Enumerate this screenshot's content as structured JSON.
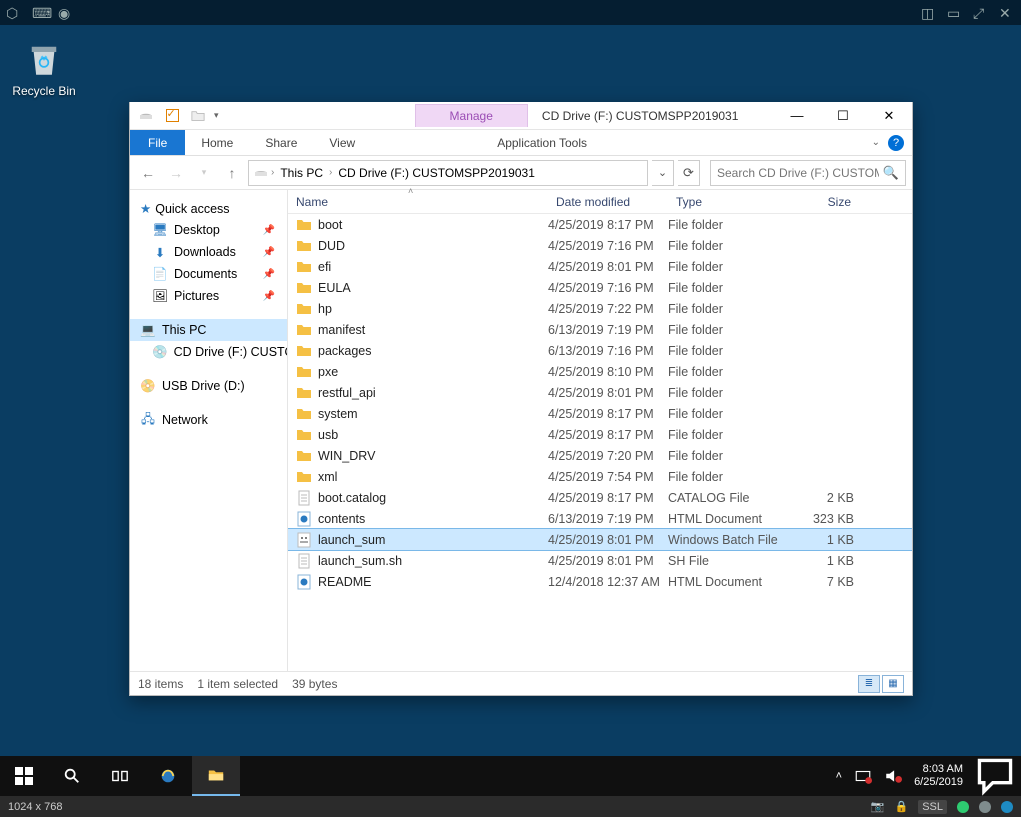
{
  "remote_controls": {},
  "desktop": {
    "recycle_bin_label": "Recycle Bin"
  },
  "window": {
    "title": "CD Drive (F:) CUSTOMSPP2019031",
    "manage_label": "Manage"
  },
  "win_buttons": {
    "min": "—",
    "max": "☐",
    "close": "✕"
  },
  "ribbon": {
    "file": "File",
    "home": "Home",
    "share": "Share",
    "view": "View",
    "application_tools": "Application Tools"
  },
  "breadcrumb": {
    "root": "This PC",
    "drive": "CD Drive (F:) CUSTOMSPP2019031"
  },
  "search": {
    "placeholder": "Search CD Drive (F:) CUSTOM..."
  },
  "nav": {
    "quick_access": "Quick access",
    "desktop": "Desktop",
    "downloads": "Downloads",
    "documents": "Documents",
    "pictures": "Pictures",
    "this_pc": "This PC",
    "cd_drive": "CD Drive (F:) CUSTOM",
    "usb_drive": "USB Drive (D:)",
    "network": "Network"
  },
  "columns": {
    "name": "Name",
    "date": "Date modified",
    "type": "Type",
    "size": "Size"
  },
  "files": [
    {
      "name": "boot",
      "date": "4/25/2019 8:17 PM",
      "type": "File folder",
      "size": "",
      "icon": "folder"
    },
    {
      "name": "DUD",
      "date": "4/25/2019 7:16 PM",
      "type": "File folder",
      "size": "",
      "icon": "folder"
    },
    {
      "name": "efi",
      "date": "4/25/2019 8:01 PM",
      "type": "File folder",
      "size": "",
      "icon": "folder"
    },
    {
      "name": "EULA",
      "date": "4/25/2019 7:16 PM",
      "type": "File folder",
      "size": "",
      "icon": "folder"
    },
    {
      "name": "hp",
      "date": "4/25/2019 7:22 PM",
      "type": "File folder",
      "size": "",
      "icon": "folder"
    },
    {
      "name": "manifest",
      "date": "6/13/2019 7:19 PM",
      "type": "File folder",
      "size": "",
      "icon": "folder"
    },
    {
      "name": "packages",
      "date": "6/13/2019 7:16 PM",
      "type": "File folder",
      "size": "",
      "icon": "folder"
    },
    {
      "name": "pxe",
      "date": "4/25/2019 8:10 PM",
      "type": "File folder",
      "size": "",
      "icon": "folder"
    },
    {
      "name": "restful_api",
      "date": "4/25/2019 8:01 PM",
      "type": "File folder",
      "size": "",
      "icon": "folder"
    },
    {
      "name": "system",
      "date": "4/25/2019 8:17 PM",
      "type": "File folder",
      "size": "",
      "icon": "folder"
    },
    {
      "name": "usb",
      "date": "4/25/2019 8:17 PM",
      "type": "File folder",
      "size": "",
      "icon": "folder"
    },
    {
      "name": "WIN_DRV",
      "date": "4/25/2019 7:20 PM",
      "type": "File folder",
      "size": "",
      "icon": "folder"
    },
    {
      "name": "xml",
      "date": "4/25/2019 7:54 PM",
      "type": "File folder",
      "size": "",
      "icon": "folder"
    },
    {
      "name": "boot.catalog",
      "date": "4/25/2019 8:17 PM",
      "type": "CATALOG File",
      "size": "2 KB",
      "icon": "file"
    },
    {
      "name": "contents",
      "date": "6/13/2019 7:19 PM",
      "type": "HTML Document",
      "size": "323 KB",
      "icon": "html"
    },
    {
      "name": "launch_sum",
      "date": "4/25/2019 8:01 PM",
      "type": "Windows Batch File",
      "size": "1 KB",
      "icon": "batch",
      "selected": true
    },
    {
      "name": "launch_sum.sh",
      "date": "4/25/2019 8:01 PM",
      "type": "SH File",
      "size": "1 KB",
      "icon": "file"
    },
    {
      "name": "README",
      "date": "12/4/2018 12:37 AM",
      "type": "HTML Document",
      "size": "7 KB",
      "icon": "html"
    }
  ],
  "statusbar": {
    "items": "18 items",
    "selected": "1 item selected",
    "bytes": "39 bytes"
  },
  "taskbar": {
    "time": "8:03 AM",
    "date": "6/25/2019"
  },
  "status_strip": {
    "resolution": "1024 x 768",
    "ssl": "SSL"
  }
}
